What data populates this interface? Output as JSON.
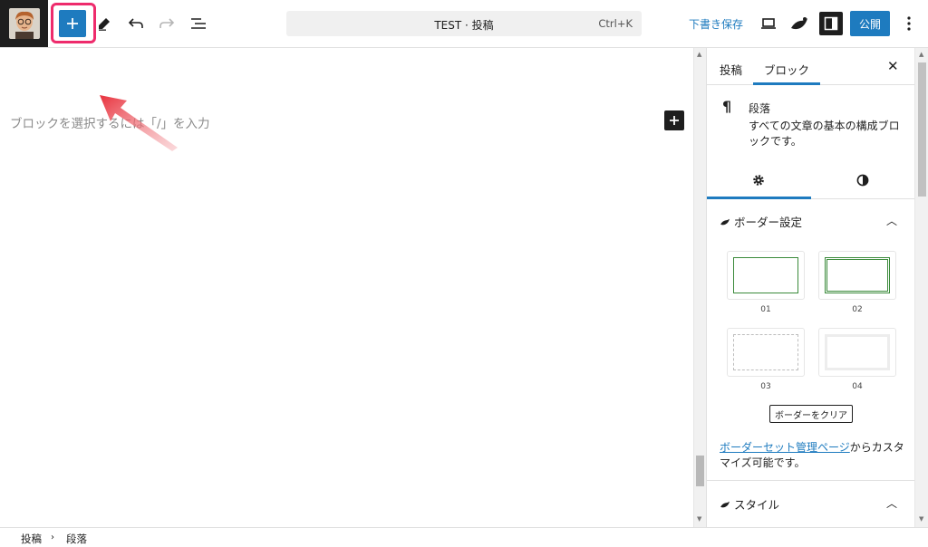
{
  "toolbar": {
    "document_title": "TEST · 投稿",
    "shortcut": "Ctrl+K",
    "save_draft_label": "下書き保存",
    "publish_label": "公開",
    "icons": {
      "inserter": "plus-icon",
      "tools": "pencil-icon",
      "undo": "undo-icon",
      "redo": "redo-icon",
      "list_view": "list-view-icon",
      "preview": "laptop-icon",
      "plugin": "bird-icon",
      "settings": "sidebar-toggle-icon",
      "more": "more-vertical-icon"
    }
  },
  "editor": {
    "placeholder": "ブロックを選択するには「/」を入力"
  },
  "sidebar": {
    "tabs": [
      "投稿",
      "ブロック"
    ],
    "active_tab": "ブロック",
    "block_card": {
      "title": "段落",
      "description": "すべての文章の基本の構成ブロックです。"
    },
    "border_panel": {
      "title": "ボーダー設定",
      "presets": [
        "01",
        "02",
        "03",
        "04"
      ],
      "clear_label": "ボーダーをクリア",
      "note_link": "ボーダーセット管理ページ",
      "note_text": "からカスタマイズ可能です。"
    },
    "style_panel": {
      "title": "スタイル"
    }
  },
  "breadcrumb": [
    "投稿",
    "段落"
  ],
  "colors": {
    "accent": "#1e7bbf",
    "highlight": "#ee2b6c",
    "arrow": "#e8313c",
    "preset_border": "#3a8a3a"
  }
}
